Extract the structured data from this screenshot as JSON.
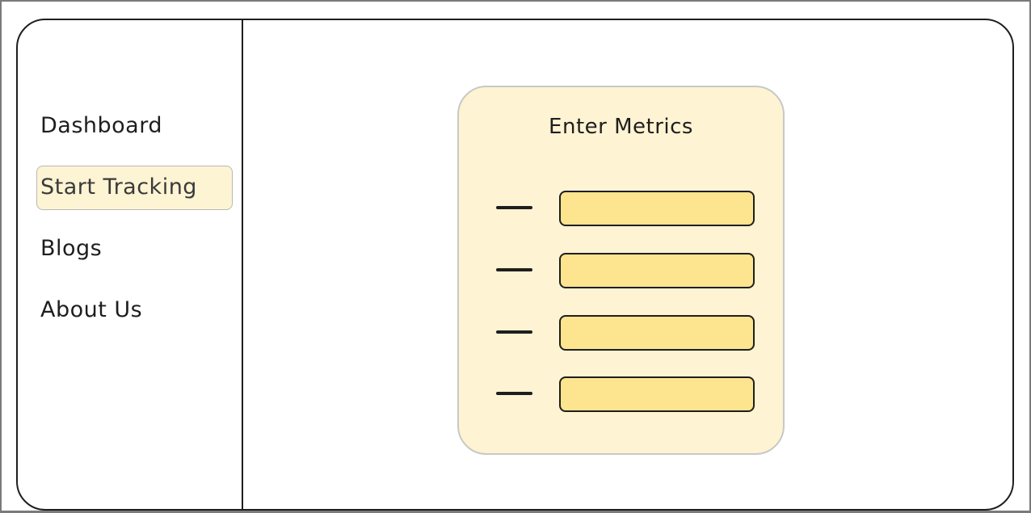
{
  "sidebar": {
    "items": [
      {
        "label": "Dashboard",
        "active": false
      },
      {
        "label": "Start Tracking",
        "active": true
      },
      {
        "label": "Blogs",
        "active": false
      },
      {
        "label": "About Us",
        "active": false
      }
    ]
  },
  "main": {
    "card": {
      "title": "Enter Metrics",
      "fields": [
        {
          "value": ""
        },
        {
          "value": ""
        },
        {
          "value": ""
        },
        {
          "value": ""
        }
      ]
    }
  },
  "colors": {
    "card_background": "#fef3d2",
    "input_fill": "#fde48f",
    "active_nav_background": "#fdf4d4",
    "stroke": "#1e1e1e"
  }
}
